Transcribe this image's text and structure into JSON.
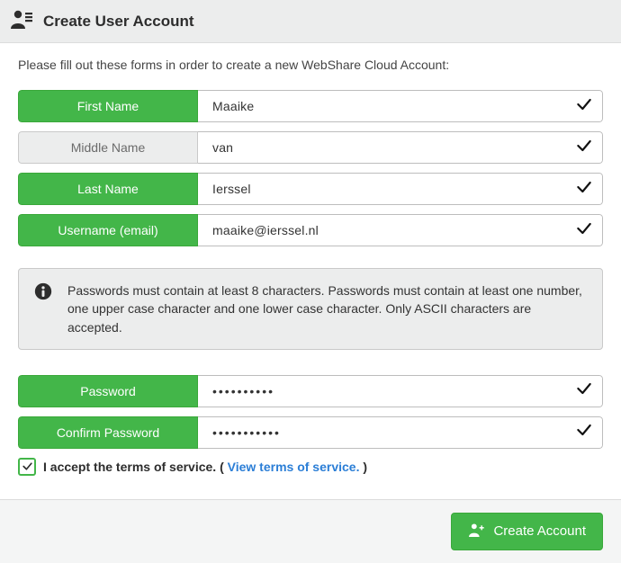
{
  "header": {
    "title": "Create User Account"
  },
  "intro": "Please fill out these forms in order to create a new WebShare Cloud Account:",
  "fields": {
    "first_name": {
      "label": "First Name",
      "value": "Maaike"
    },
    "middle_name": {
      "label": "Middle Name",
      "value": "van"
    },
    "last_name": {
      "label": "Last Name",
      "value": "Ierssel"
    },
    "username": {
      "label": "Username (email)",
      "value": "maaike@ierssel.nl"
    },
    "password": {
      "label": "Password",
      "value": "••••••••••"
    },
    "confirm_password": {
      "label": "Confirm Password",
      "value": "•••••••••••"
    }
  },
  "info_text": "Passwords must contain at least 8 characters. Passwords must contain at least one number, one upper case character and one lower case character. Only ASCII characters are accepted.",
  "terms": {
    "prefix": "I accept the terms of service. ( ",
    "link": "View terms of service.",
    "suffix": " )",
    "checked": true
  },
  "create_button": "Create Account",
  "colors": {
    "accent": "#43b649",
    "link": "#2b7ed6"
  }
}
